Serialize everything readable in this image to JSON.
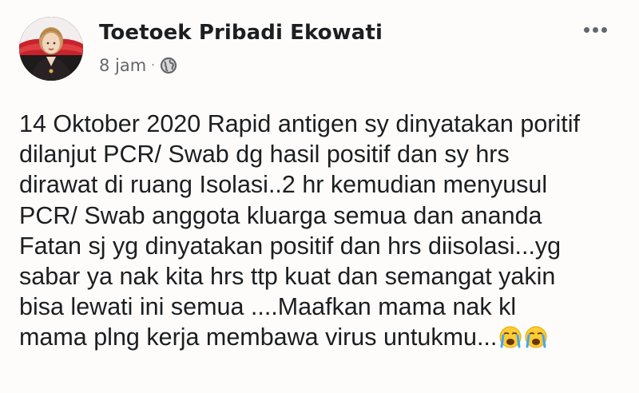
{
  "post": {
    "author": "Toetoek Pribadi Ekowati",
    "time": "8 jam",
    "separator": "·",
    "privacy_icon": "globe-icon",
    "more_icon": "more-options-icon",
    "body_lines": [
      "14 Oktober 2020 Rapid antigen sy dinyatakan poritif",
      "dilanjut PCR/ Swab dg hasil positif dan sy hrs",
      "dirawat di ruang Isolasi..2 hr kemudian menyusul",
      "PCR/ Swab anggota kluarga semua dan ananda",
      "Fatan sj yg dinyatakan positif dan  hrs diisolasi...yg",
      "sabar ya nak kita hrs ttp kuat dan semangat yakin",
      "bisa lewati ini semua ....Maafkan mama nak kl",
      "mama plng kerja membawa virus untukmu..."
    ],
    "trailing_emoji": "loudly-crying-face-icon"
  },
  "colors": {
    "background": "#fdfcfa",
    "text": "#1c1e21",
    "meta": "#65676b"
  }
}
